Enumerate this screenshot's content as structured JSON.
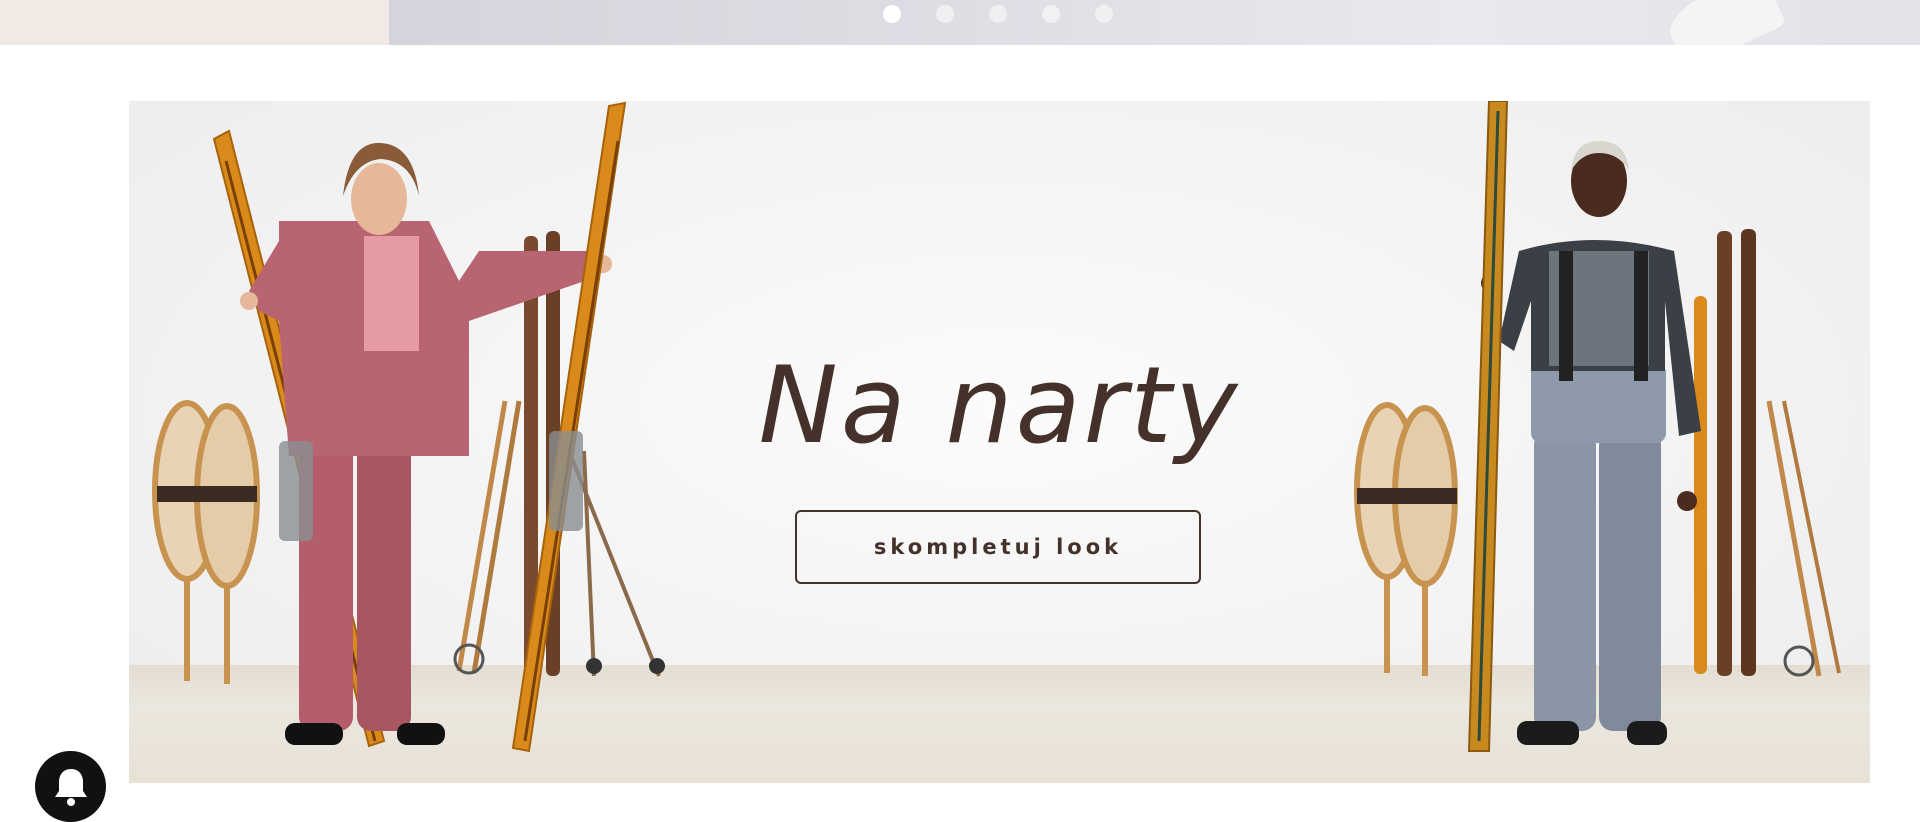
{
  "carousel": {
    "dot_count": 5,
    "active_index": 0
  },
  "hero": {
    "title": "Na narty",
    "cta_label": "skompletuj look"
  },
  "icons": {
    "notification": "bell-icon"
  },
  "colors": {
    "title_brown": "#44312a",
    "pink_outfit": "#b5626d",
    "grey_pants": "#8a96a6",
    "ski_orange": "#d9891b",
    "floor_beige": "#e5dfd4"
  }
}
